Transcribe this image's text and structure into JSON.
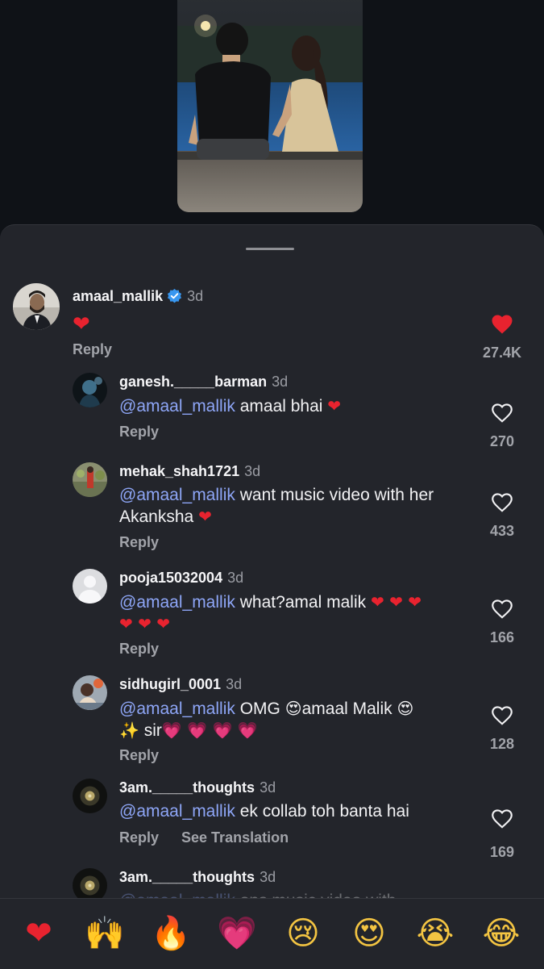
{
  "comments": [
    {
      "username": "amaal_mallik",
      "verified": true,
      "age": "3d",
      "text": "❤",
      "reply": "Reply",
      "likes": "27.4K",
      "liked": true
    },
    {
      "username": "ganesh._____barman",
      "age": "3d",
      "mention": "@amaal_mallik",
      "text": "amaal bhai",
      "reply": "Reply",
      "likes": "270"
    },
    {
      "username": "mehak_shah1721",
      "age": "3d",
      "mention": "@amaal_mallik",
      "text": "want music video with her",
      "text2": "Akanksha",
      "reply": "Reply",
      "likes": "433"
    },
    {
      "username": "pooja15032004",
      "age": "3d",
      "mention": "@amaal_mallik",
      "text": "what?amal malik",
      "reply": "Reply",
      "likes": "166"
    },
    {
      "username": "sidhugirl_0001",
      "age": "3d",
      "mention": "@amaal_mallik",
      "text": "OMG",
      "text_b": "amaal Malik",
      "text2": "sir",
      "reply": "Reply",
      "likes": "128"
    },
    {
      "username": "3am._____thoughts",
      "age": "3d",
      "mention": "@amaal_mallik",
      "text": " ek collab toh banta hai",
      "reply": "Reply",
      "see_translation": "See Translation",
      "likes": "169"
    },
    {
      "username": "3am._____thoughts",
      "age": "3d",
      "mention": "@amaal_mallik",
      "text": "ons music video with"
    }
  ],
  "reactions": [
    "❤",
    "🙌",
    "🔥",
    "💗",
    "😢",
    "😍",
    "😭",
    "😂"
  ],
  "colors": {
    "background": "#0f1217",
    "sheet": "#23252b",
    "mention": "#8ea6f7",
    "like_red": "#e8232f",
    "verified_blue": "#3897f0"
  }
}
